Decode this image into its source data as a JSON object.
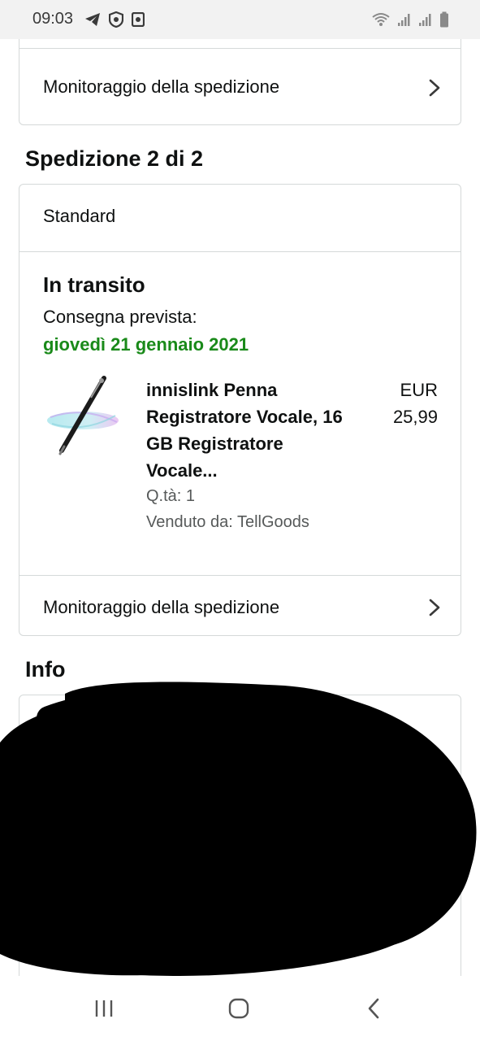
{
  "status_bar": {
    "time": "09:03",
    "left_icons": [
      "telegram-icon",
      "shield-icon",
      "app-icon"
    ],
    "right_icons": [
      "wifi-icon",
      "signal-icon",
      "signal-icon",
      "battery-icon"
    ]
  },
  "shipment_1": {
    "track_label": "Monitoraggio della spedizione"
  },
  "shipment_2": {
    "heading": "Spedizione 2 di 2",
    "type": "Standard",
    "status": "In transito",
    "delivery_label": "Consegna prevista:",
    "delivery_date": "giovedì 21 gennaio 2021",
    "product": {
      "title": "innislink Penna Registratore Vocale, 16 GB Registratore Vocale...",
      "price_currency": "EUR",
      "price_value": "25,99",
      "quantity": "Q.tà: 1",
      "seller": "Venduto da: TellGoods"
    },
    "track_label": "Monitoraggio della spedizione"
  },
  "info_section": {
    "heading_visible": "Info"
  },
  "colors": {
    "accent_green": "#1a8a1a",
    "border": "#d5d9d9",
    "text": "#0f1111",
    "muted": "#565959"
  },
  "nav": {
    "buttons": [
      "recent-apps-icon",
      "home-icon",
      "back-icon"
    ]
  }
}
